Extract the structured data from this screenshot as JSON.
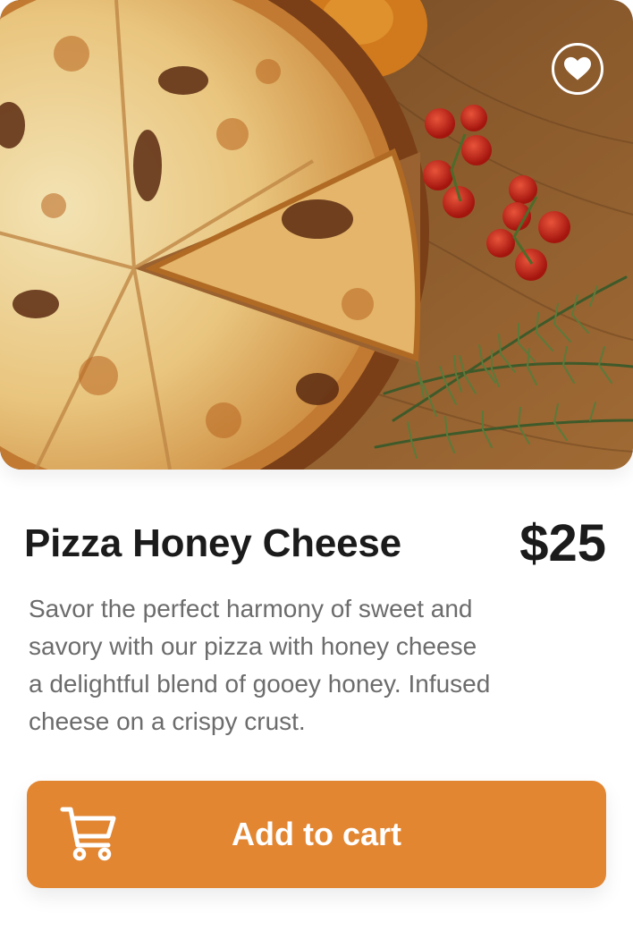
{
  "product": {
    "name": "Pizza Honey Cheese",
    "price": "$25",
    "description_lines": [
      "Savor the perfect harmony of sweet and",
      "savory with our pizza with honey cheese",
      "a delightful blend of gooey honey. Infused",
      "cheese on a crispy crust."
    ]
  },
  "actions": {
    "add_to_cart_label": "Add to cart",
    "cart_icon": "shopping-cart-icon",
    "favorite_icon": "heart-icon"
  },
  "colors": {
    "accent": "#e28632",
    "title": "#1b1b1b",
    "body_text": "#6c6c6c",
    "background": "#ffffff"
  }
}
